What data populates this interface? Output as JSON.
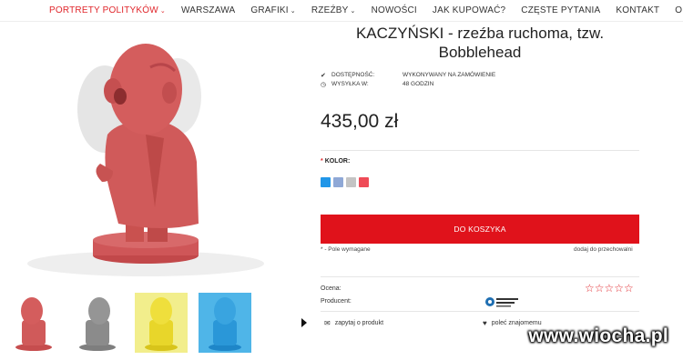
{
  "nav": {
    "items": [
      {
        "label": "PORTRETY POLITYKÓW",
        "dropdown": true,
        "active": true
      },
      {
        "label": "WARSZAWA",
        "dropdown": false,
        "active": false
      },
      {
        "label": "GRAFIKI",
        "dropdown": true,
        "active": false
      },
      {
        "label": "RZEŹBY",
        "dropdown": true,
        "active": false
      },
      {
        "label": "NOWOŚCI",
        "dropdown": false,
        "active": false
      },
      {
        "label": "JAK KUPOWAĆ?",
        "dropdown": false,
        "active": false
      },
      {
        "label": "CZĘSTE PYTANIA",
        "dropdown": false,
        "active": false
      },
      {
        "label": "KONTAKT",
        "dropdown": false,
        "active": false
      },
      {
        "label": "O NAS",
        "dropdown": false,
        "active": false
      }
    ],
    "chevron": "⌄"
  },
  "product": {
    "title": "KACZYŃSKI - rzeźba ruchoma, tzw. Bobblehead",
    "availability_label": "DOSTĘPNOŚĆ:",
    "availability_value": "WYKONYWANY NA ZAMÓWIENIE",
    "shipping_label": "WYSYŁKA W:",
    "shipping_value": "48 GODZIN",
    "price": "435,00 zł",
    "color_label": "KOLOR:",
    "color_required_mark": "*",
    "swatch_colors": [
      "#2196e8",
      "#8fa8d6",
      "#c4c4c4",
      "#ef4b57"
    ],
    "add_to_cart": "DO KOSZYKA",
    "required_note": "* - Pole wymagane",
    "store_link": "dodaj do przechowalni",
    "rating_label": "Ocena:",
    "stars": "☆☆☆☆☆",
    "producer_label": "Producent:",
    "ask_link": "zapytaj o produkt",
    "recommend_link": "poleć znajomemu"
  },
  "thumbnails": [
    "red",
    "gray",
    "yellow",
    "blue"
  ],
  "colors": {
    "accent": "#e0262b",
    "button": "#e0121b"
  },
  "watermark": "www.wiocha.pl"
}
